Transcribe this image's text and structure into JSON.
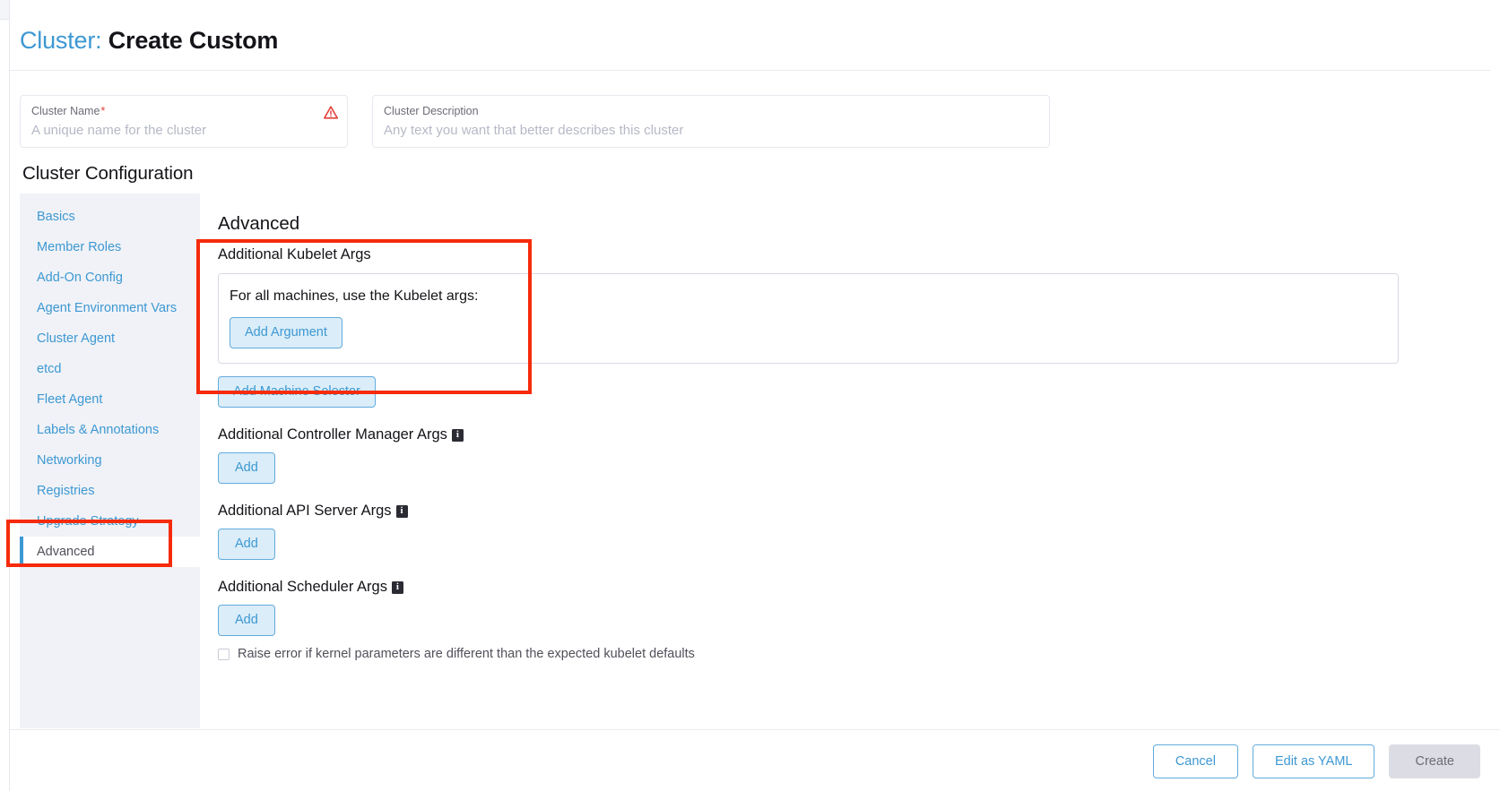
{
  "header": {
    "title_kind": "Cluster:",
    "title_name": "Create Custom"
  },
  "fields": {
    "cluster_name": {
      "label": "Cluster Name",
      "required_marker": "*",
      "placeholder": "A unique name for the cluster",
      "value": "",
      "warning_icon": "warning-triangle-icon",
      "warning_color": "#e2413c"
    },
    "cluster_description": {
      "label": "Cluster Description",
      "placeholder": "Any text you want that better describes this cluster",
      "value": ""
    }
  },
  "config": {
    "section_title": "Cluster Configuration",
    "nav_items": [
      {
        "label": "Basics",
        "active": false
      },
      {
        "label": "Member Roles",
        "active": false
      },
      {
        "label": "Add-On Config",
        "active": false
      },
      {
        "label": "Agent Environment Vars",
        "active": false
      },
      {
        "label": "Cluster Agent",
        "active": false
      },
      {
        "label": "etcd",
        "active": false
      },
      {
        "label": "Fleet Agent",
        "active": false
      },
      {
        "label": "Labels & Annotations",
        "active": false
      },
      {
        "label": "Networking",
        "active": false
      },
      {
        "label": "Registries",
        "active": false
      },
      {
        "label": "Upgrade Strategy",
        "active": false
      },
      {
        "label": "Advanced",
        "active": true
      }
    ]
  },
  "panel": {
    "title": "Advanced",
    "kubelet": {
      "heading": "Additional Kubelet Args",
      "selector_text": "For all machines, use the Kubelet args:",
      "add_argument_label": "Add Argument",
      "add_machine_selector_label": "Add Machine Selector"
    },
    "arg_sections": [
      {
        "heading": "Additional Controller Manager Args",
        "has_info": true,
        "add_label": "Add"
      },
      {
        "heading": "Additional API Server Args",
        "has_info": true,
        "add_label": "Add"
      },
      {
        "heading": "Additional Scheduler Args",
        "has_info": true,
        "add_label": "Add"
      }
    ],
    "kernel_checkbox": {
      "label": "Raise error if kernel parameters are different than the expected kubelet defaults",
      "checked": false
    }
  },
  "footer": {
    "cancel_label": "Cancel",
    "edit_yaml_label": "Edit as YAML",
    "create_label": "Create",
    "create_disabled": true
  },
  "annotations": {
    "highlight_color": "#f62b0b",
    "boxes": [
      {
        "name": "kubelet-args-highlight"
      },
      {
        "name": "advanced-nav-highlight"
      }
    ]
  },
  "colors": {
    "link_blue": "#3d98d3",
    "button_fill": "#dbedf8",
    "nav_background": "#f0f2f7"
  }
}
